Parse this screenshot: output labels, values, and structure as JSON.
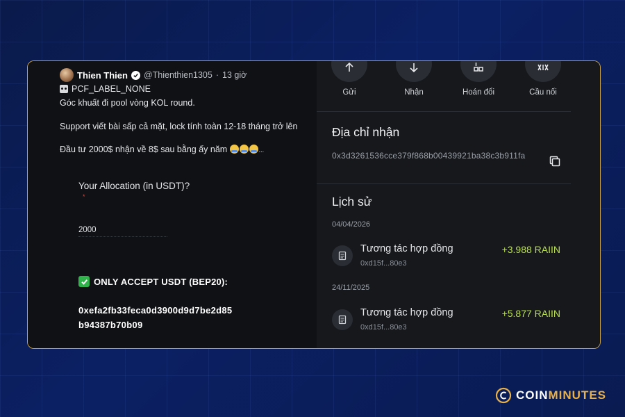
{
  "tweet": {
    "name": "Thien Thien",
    "handle": "@Thienthien1305",
    "separator": "·",
    "time": "13 giờ",
    "label": "PCF_LABEL_NONE",
    "line1": "Góc khuất đi pool vòng KOL round.",
    "line2": "Support viết bài sấp cả mặt, lock tính toàn 12-18 tháng trở lên",
    "line3": "Đầu tư 2000$ nhận về 8$ sau bằng ấy năm",
    "line3_suffix": "..."
  },
  "form": {
    "question": "Your Allocation (in USDT)?",
    "required_mark": "*",
    "value": "2000",
    "accept_text": "ONLY ACCEPT USDT (BEP20):",
    "address_line1": "0xefa2fb33feca0d3900d9d7be2d85",
    "address_line2": "b94387b70b09"
  },
  "wallet": {
    "actions": [
      {
        "label": "Gửi",
        "icon": "arrow-up-icon"
      },
      {
        "label": "Nhận",
        "icon": "arrow-down-icon"
      },
      {
        "label": "Hoán đổi",
        "icon": "swap-icon"
      },
      {
        "label": "Cầu nối",
        "icon": "bridge-icon"
      }
    ],
    "receive_title": "Địa chỉ nhận",
    "receive_address": "0x3d3261536cce379f868b00439921ba38c3b911fa",
    "history_title": "Lịch sử",
    "history": [
      {
        "date": "04/04/2026",
        "title": "Tương tác hợp đồng",
        "sub": "0xd15f...80e3",
        "amount": "+3.988 RAIIN"
      },
      {
        "date": "24/11/2025",
        "title": "Tương tác hợp đồng",
        "sub": "0xd15f...80e3",
        "amount": "+5.877 RAIIN"
      }
    ]
  },
  "brand": {
    "text_a": "COIN",
    "text_b": "MINUTES",
    "accent_color": "#e8b14a"
  },
  "colors": {
    "card_border": "#c9a24a",
    "amount_green": "#b8e04a",
    "background": "#0b2063"
  }
}
